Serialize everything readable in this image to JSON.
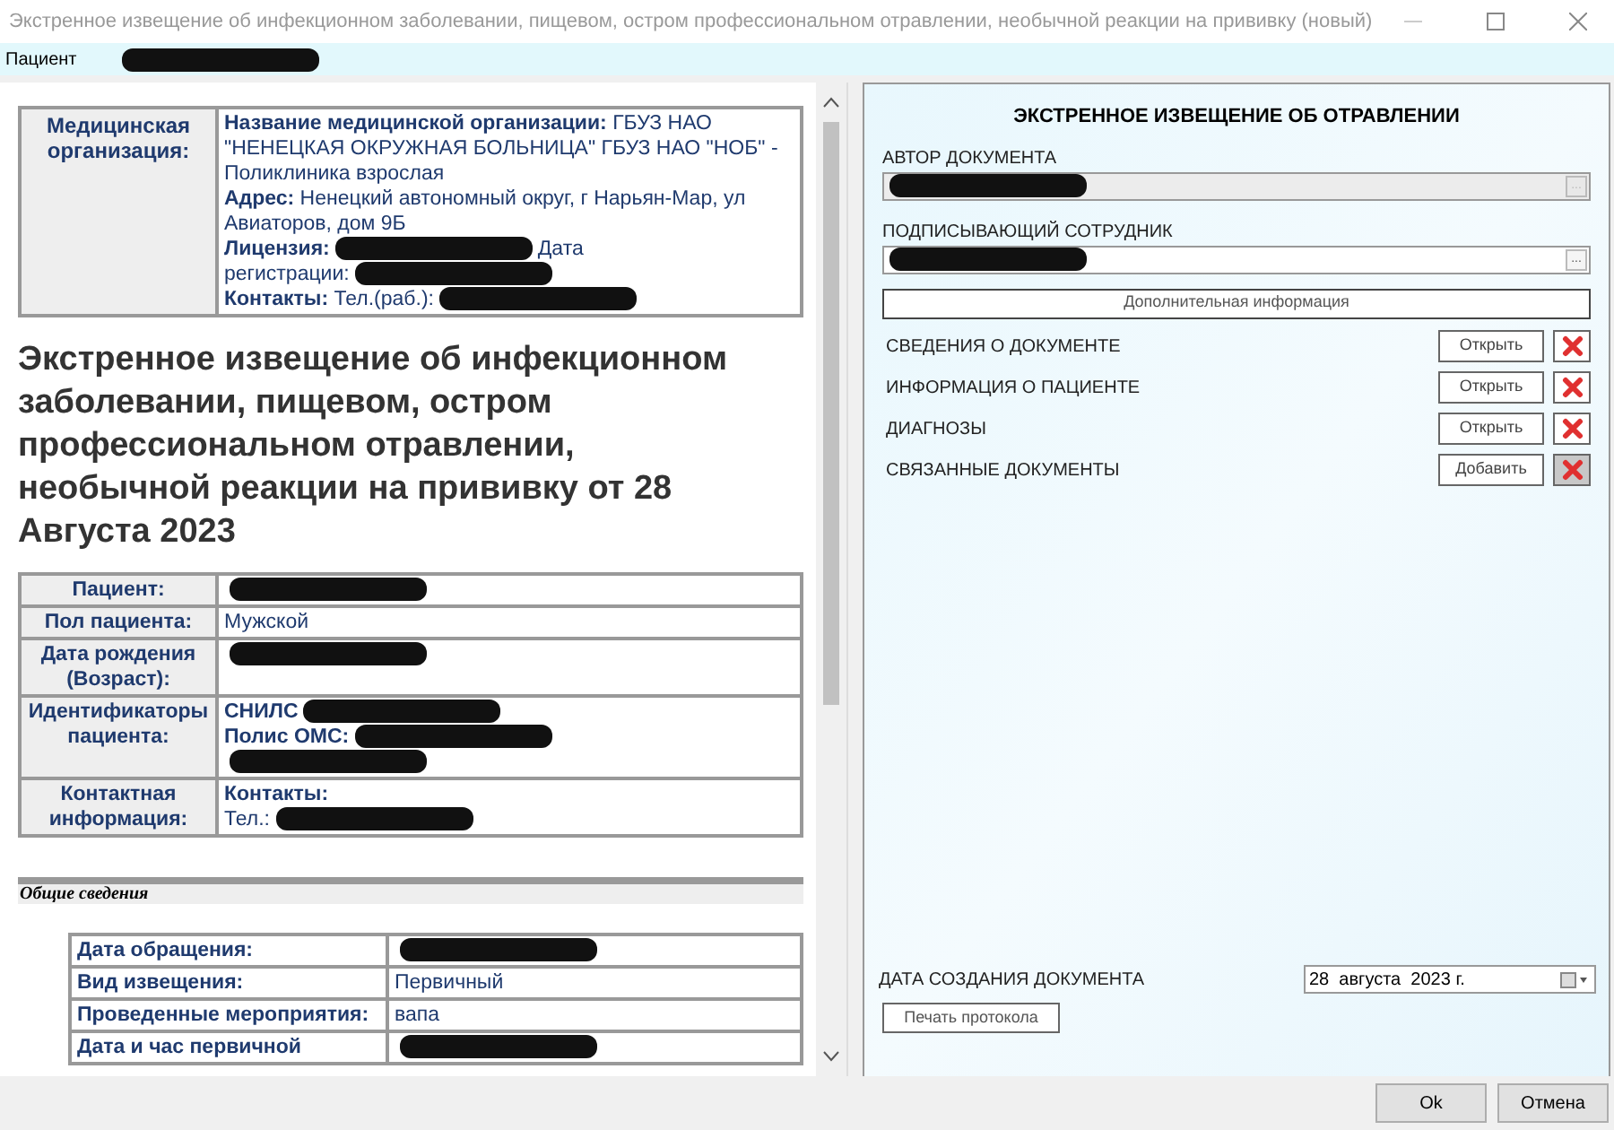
{
  "window": {
    "title": "Экстренное извещение об инфекционном заболевании, пищевом, остром профессиональном отравлении, необычной реакции на прививку  (новый)"
  },
  "patient_bar": {
    "label": "Пациент",
    "value": {
      "kind": "redacted"
    }
  },
  "document": {
    "org_table": {
      "header": "Медицинская организация:",
      "lines": [
        [
          {
            "kind": "text",
            "text": "**Название медицинской организации:** ГБУЗ НАО \"НЕНЕЦКАЯ ОКРУЖНАЯ БОЛЬНИЦА\" ГБУЗ НАО \"НОБ\" - Поликлиника взрослая"
          }
        ],
        [
          {
            "kind": "text",
            "text": "**Адрес:** Ненецкий автономный округ, г Нарьян-Мар, ул Авиаторов, дом 9Б"
          }
        ],
        [
          {
            "kind": "text",
            "text": "**Лицензия:**"
          },
          {
            "kind": "redacted"
          },
          {
            "kind": "text",
            "text": "Дата"
          }
        ],
        [
          {
            "kind": "text",
            "text": "регистрации:"
          },
          {
            "kind": "redacted"
          }
        ],
        [
          {
            "kind": "text",
            "text": "**Контакты:** Тел.(раб.):"
          },
          {
            "kind": "redacted"
          }
        ]
      ]
    },
    "heading": "Экстренное извещение об инфекционном заболевании, пищевом, остром профессиональном отравлении, необычной реакции на прививку от 28 Августа 2023",
    "patient_table": [
      {
        "label": "Пациент:",
        "lines": [
          [
            {
              "kind": "redacted"
            }
          ]
        ]
      },
      {
        "label": "Пол пациента:",
        "lines": [
          [
            {
              "kind": "text",
              "text": "Мужской"
            }
          ]
        ]
      },
      {
        "label": "Дата рождения (Возраст):",
        "lines": [
          [
            {
              "kind": "redacted"
            }
          ]
        ]
      },
      {
        "label": "Идентификаторы пациента:",
        "lines": [
          [
            {
              "kind": "text",
              "text": "**СНИЛС**"
            },
            {
              "kind": "redacted"
            }
          ],
          [
            {
              "kind": "text",
              "text": "**Полис ОМС:**"
            },
            {
              "kind": "redacted"
            }
          ],
          [
            {
              "kind": "redacted"
            }
          ]
        ]
      },
      {
        "label": "Контактная информация:",
        "lines": [
          [
            {
              "kind": "text",
              "text": "**Контакты:**"
            }
          ],
          [
            {
              "kind": "text",
              "text": "Тел.:"
            },
            {
              "kind": "redacted"
            }
          ]
        ]
      }
    ],
    "section_title": "Общие сведения",
    "general_table": [
      {
        "label": "Дата обращения:",
        "lines": [
          [
            {
              "kind": "redacted"
            }
          ]
        ]
      },
      {
        "label": "Вид извещения:",
        "lines": [
          [
            {
              "kind": "text",
              "text": "Первичный"
            }
          ]
        ]
      },
      {
        "label": "Проведенные мероприятия:",
        "lines": [
          [
            {
              "kind": "text",
              "text": "вапа"
            }
          ]
        ]
      },
      {
        "label": "Дата и час первичной",
        "lines": [
          [
            {
              "kind": "redacted"
            }
          ]
        ]
      }
    ]
  },
  "panel": {
    "title": "ЭКСТРЕННОЕ ИЗВЕЩЕНИЕ ОБ ОТРАВЛЕНИИ",
    "fields": [
      {
        "label": "АВТОР ДОКУМЕНТА",
        "disabled": true,
        "button": "...",
        "value": {
          "kind": "redacted"
        }
      },
      {
        "label": "ПОДПИСЫВАЮЩИЙ СОТРУДНИК",
        "disabled": false,
        "button": "...",
        "value": {
          "kind": "redacted"
        }
      }
    ],
    "extra_button": "Дополнительная информация",
    "sections": [
      {
        "label": "СВЕДЕНИЯ О ДОКУМЕНТЕ",
        "button": "Открыть",
        "delete_disabled": false
      },
      {
        "label": "ИНФОРМАЦИЯ О ПАЦИЕНТЕ",
        "button": "Открыть",
        "delete_disabled": false
      },
      {
        "label": "ДИАГНОЗЫ",
        "button": "Открыть",
        "delete_disabled": false
      },
      {
        "label": "СВЯЗАННЫЕ ДОКУМЕНТЫ",
        "button": "Добавить",
        "delete_disabled": true
      }
    ],
    "date_label": "ДАТА СОЗДАНИЯ ДОКУМЕНТА",
    "date_value": "28  августа  2023 г.",
    "print_button": "Печать протокола"
  },
  "footer": {
    "buttons": [
      "Ok",
      "Отмена"
    ]
  }
}
